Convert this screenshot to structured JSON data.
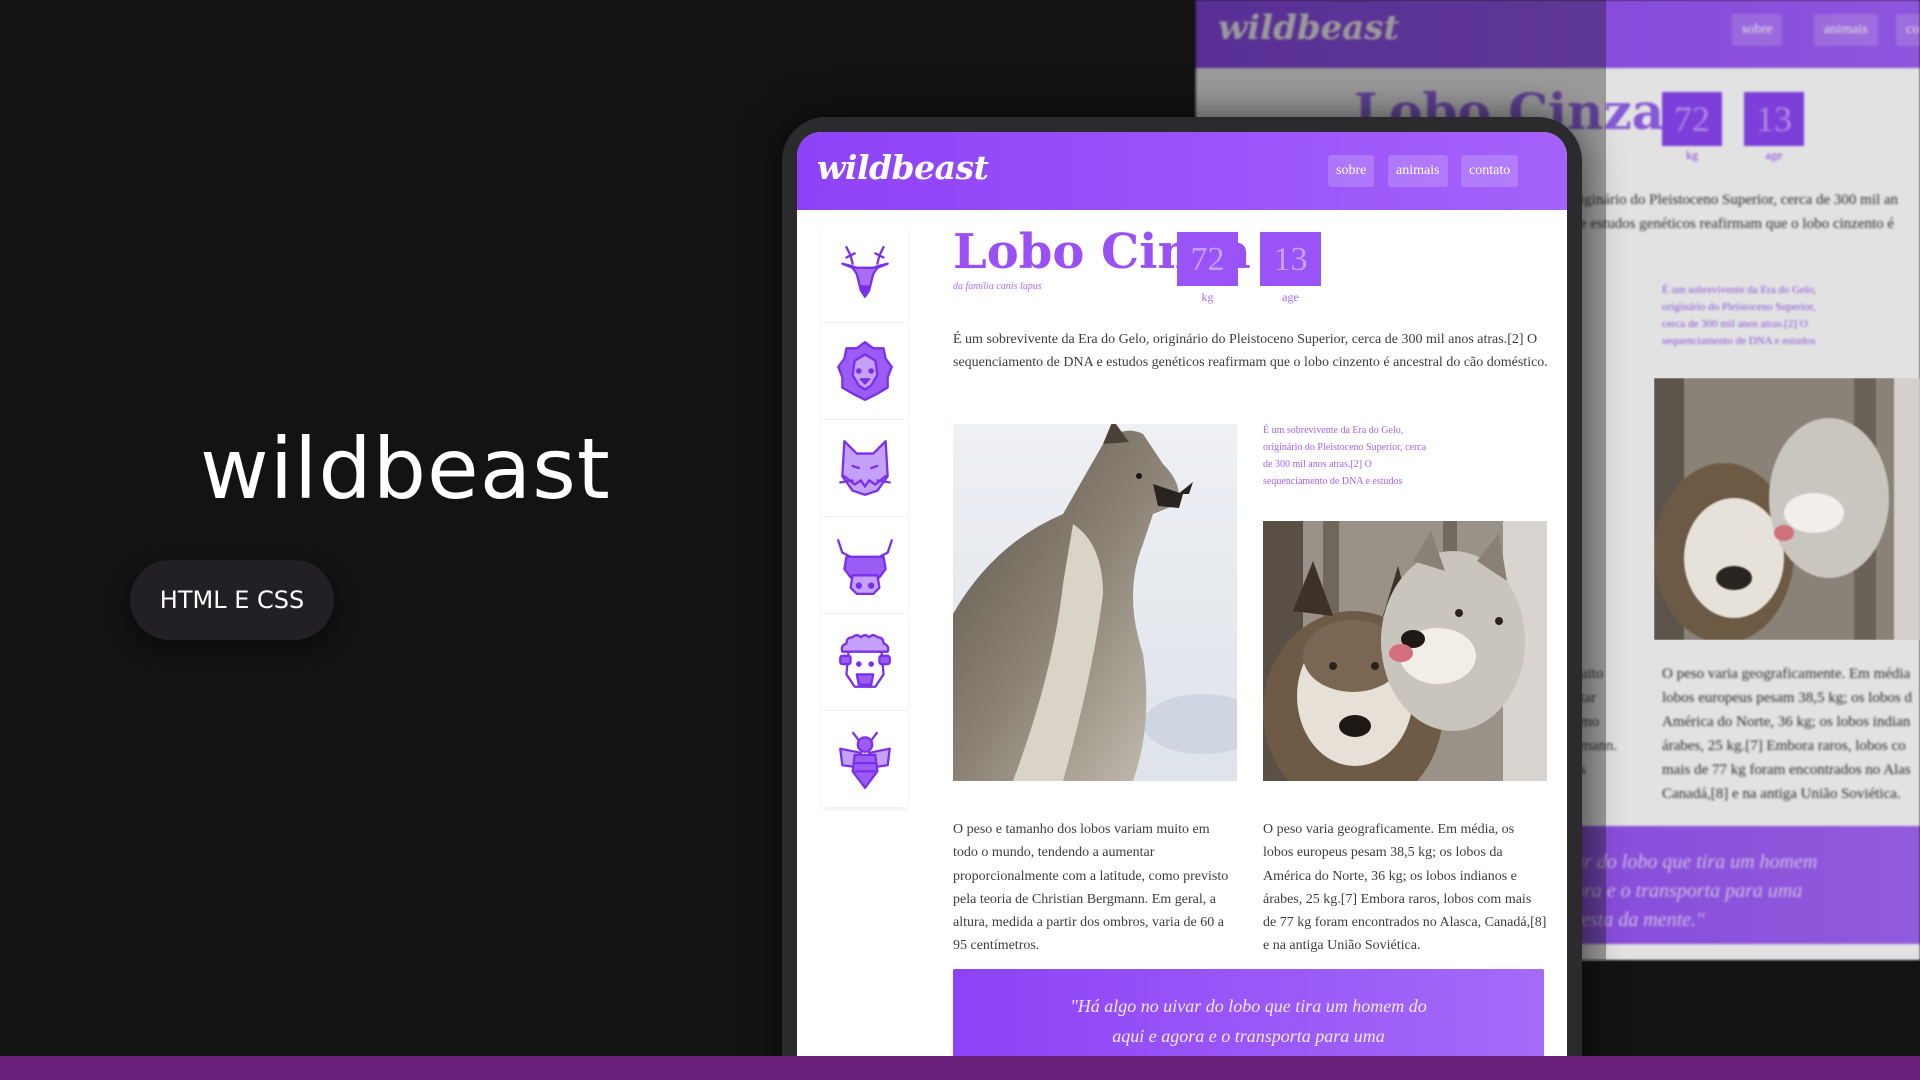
{
  "hero": {
    "title": "wildbeast",
    "pill": "HTML E CSS"
  },
  "site": {
    "logo": "wildbeast",
    "nav": [
      "sobre",
      "animais",
      "contato"
    ],
    "sidebar_icons": [
      "deer-icon",
      "lion-icon",
      "cat-icon",
      "ox-icon",
      "sheep-icon",
      "bee-icon"
    ],
    "animal": {
      "name": "Lobo Cinza",
      "family": "da família canis lupus",
      "stats": [
        {
          "value": "72",
          "label": "kg"
        },
        {
          "value": "13",
          "label": "age"
        }
      ]
    },
    "intro": "É um sobrevivente da Era do Gelo, originário do Pleistoceno Superior, cerca de 300 mil anos atras.[2] O sequenciamento de DNA e estudos genéticos reafirmam que o lobo cinzento é ancestral do cão doméstico.",
    "side_note": "É um sobrevivente da Era do Gelo, originário do Pleistoceno Superior, cerca de 300 mil anos atras.[2] O sequenciamento de DNA e estudos",
    "col1": "O peso e tamanho dos lobos variam muito em todo o mundo, tendendo a aumentar proporcionalmente com a latitude, como previsto pela teoria de Christian Bergmann. Em geral, a altura, medida a partir dos ombros, varia de 60 a 95 centímetros.",
    "col2": "O peso varia geograficamente. Em média, os lobos europeus pesam 38,5 kg; os lobos da América do Norte, 36 kg; os lobos indianos e árabes, 25 kg.[7] Embora raros, lobos com mais de 77 kg foram encontrados no Alasca, Canadá,[8] e na antiga União Soviética.",
    "quote": "\"Há algo no uivar do lobo que tira um homem do aqui e agora e o transporta para uma"
  },
  "background_page": {
    "logo": "wildbeast",
    "nav": [
      "sobre",
      "animais",
      "cont"
    ],
    "title": "Lobo Cinza",
    "stats": [
      {
        "value": "72",
        "label": "kg"
      },
      {
        "value": "13",
        "label": "age"
      }
    ],
    "intro": "iginário do Pleistoceno Superior, cerca de 300 mil an\ne estudos genéticos reafirmam que o lobo cinzento é",
    "side_note": "É um sobrevivente da Era do Gelo, originário do Pleistoceno Superior, cerca de 300 mil anos atras.[2] O sequenciamento de DNA e estudos",
    "col_left": "uito\ntar\nmo\nmann.\ns",
    "col_right": "O peso varia geograficamente. Em média\nlobos europeus pesam 38,5 kg; os lobos d\nAmérica do Norte, 36 kg; os lobos indian\nárabes, 25 kg.[7] Embora raros, lobos co\nmais de 77 kg foram encontrados no Alas\nCanadá,[8] e na antiga União Soviética.",
    "quote": "ar do lobo que tira um homem\nora e o transporta para uma\nresta da mente.\""
  },
  "colors": {
    "accent": "#9a50f5",
    "nav_start": "#8e42f7",
    "nav_end": "#a462fa",
    "background": "#141314",
    "bottom_bar": "#6a1f7a"
  }
}
